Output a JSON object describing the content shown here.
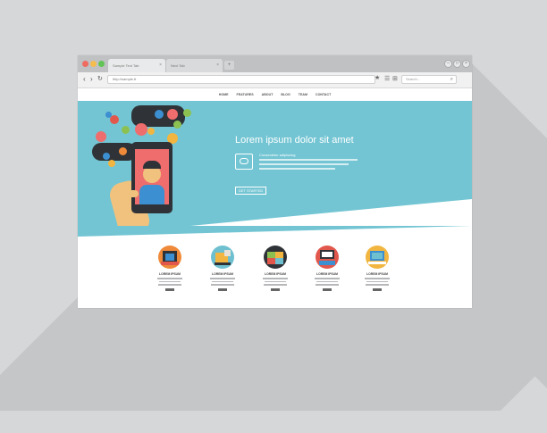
{
  "browser": {
    "tabs": [
      {
        "label": "Sample Text Tab",
        "close": "×"
      },
      {
        "label": "Next Tab",
        "close": "×"
      }
    ],
    "new_tab": "+",
    "traffic_lights": [
      "#ee6b62",
      "#f5bd4f",
      "#61c454"
    ],
    "window_controls": [
      "–",
      "□",
      "×"
    ],
    "nav": {
      "back": "‹",
      "forward": "›",
      "reload": "↻"
    },
    "address": "http://sample.tt",
    "toolbar_icons": {
      "star": "★",
      "menu": "☰",
      "save": "⊞"
    },
    "search_placeholder": "Search...",
    "search_icon": "⌕"
  },
  "site_nav": [
    "HOME",
    "FEATURES",
    "ABOUT",
    "BLOG",
    "TEAM",
    "CONTACT"
  ],
  "hero": {
    "title": "Lorem ipsum dolor sit amet",
    "feature_title": "Consectetur adipiscing",
    "cta_label": "GET STARTED",
    "background": "#73c5d3",
    "accent_red": "#ef6d6d"
  },
  "features": [
    {
      "title": "LOREM IPSUM",
      "palette": [
        "#2f3338",
        "#ef8a3a",
        "#e2574c",
        "#3c8fd0"
      ]
    },
    {
      "title": "LOREM IPSUM",
      "palette": [
        "#6ec0d0",
        "#f2b640",
        "#e8e1d6",
        "#2f3338"
      ]
    },
    {
      "title": "LOREM IPSUM",
      "palette": [
        "#2f3338",
        "#8cc152",
        "#f2b640",
        "#e2574c"
      ]
    },
    {
      "title": "LOREM IPSUM",
      "palette": [
        "#2f3338",
        "#e2574c",
        "#ffffff",
        "#3c8fd0"
      ]
    },
    {
      "title": "LOREM IPSUM",
      "palette": [
        "#f2b640",
        "#3c8fd0",
        "#6ec0d0",
        "#ffffff"
      ]
    }
  ]
}
